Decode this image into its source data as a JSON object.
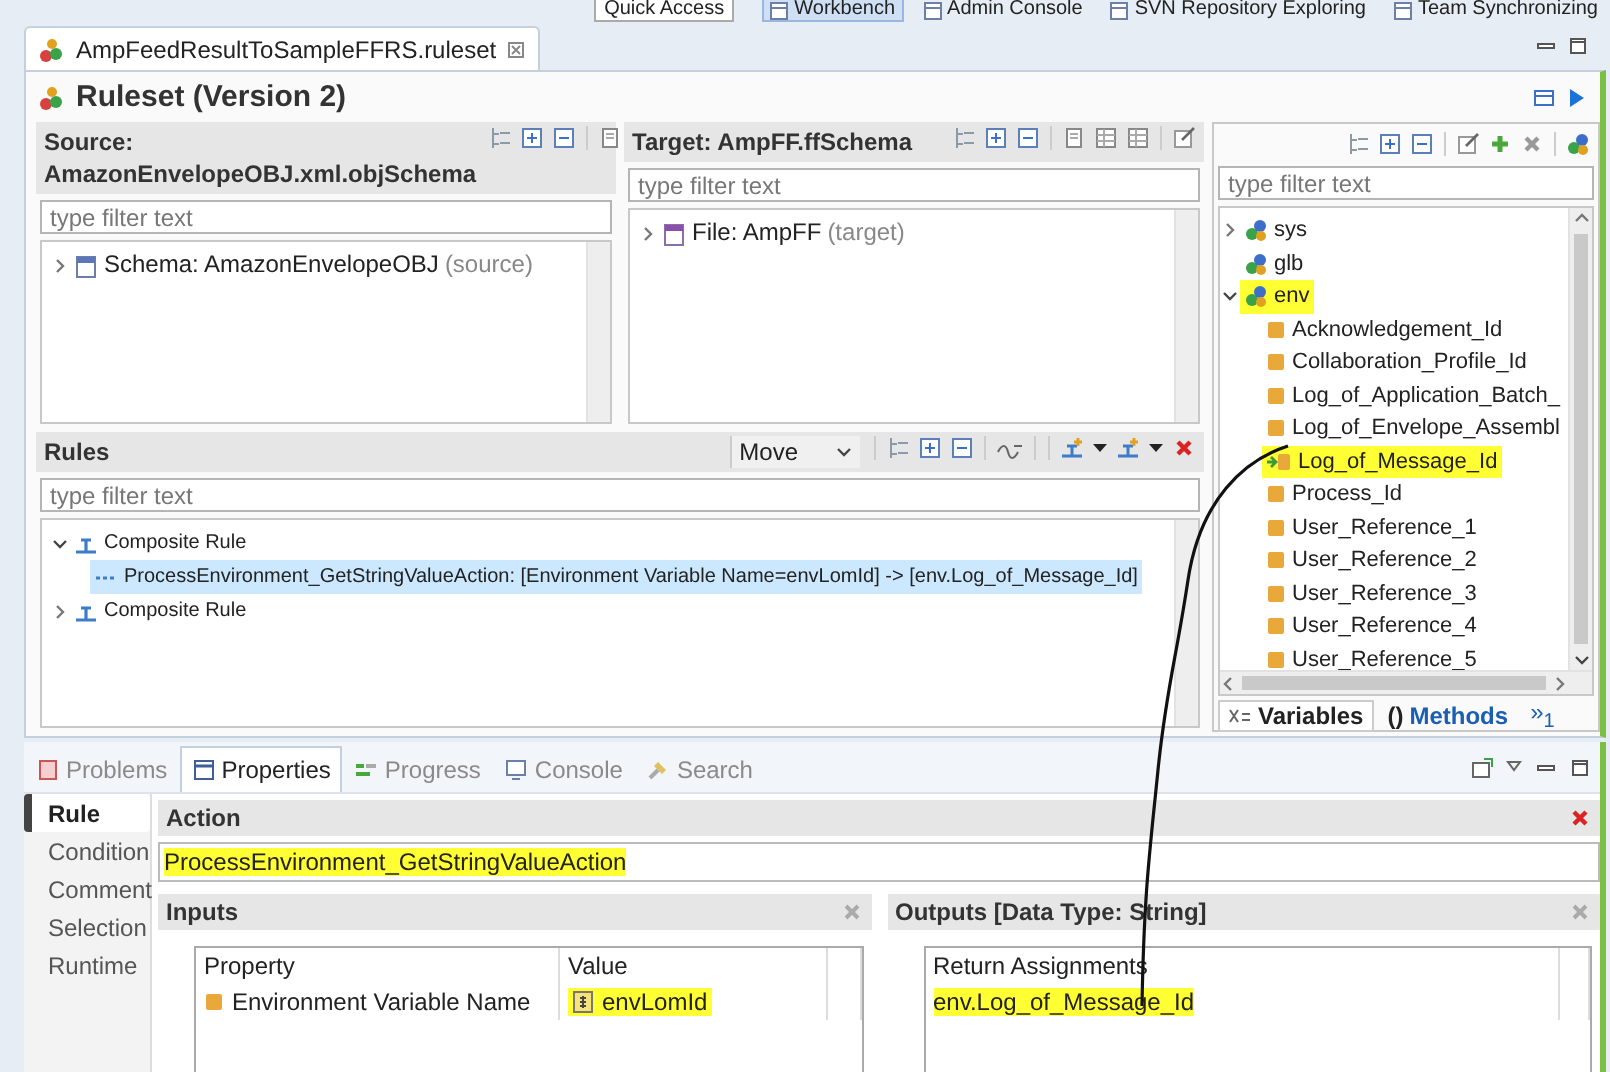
{
  "perspective_bar": {
    "quick_access": "Quick Access",
    "perspectives": [
      {
        "label": "Workbench",
        "selected": true
      },
      {
        "label": "Admin Console",
        "selected": false
      },
      {
        "label": "SVN Repository Exploring",
        "selected": false
      },
      {
        "label": "Team Synchronizing",
        "selected": false
      }
    ]
  },
  "editor_tab": {
    "title": "AmpFeedResultToSampleFFRS.ruleset"
  },
  "ruleset_title": "Ruleset (Version 2)",
  "source": {
    "title": "Source: AmazonEnvelopeOBJ.xml.objSchema",
    "filter_placeholder": "type filter text",
    "tree": [
      {
        "label": "Schema: AmazonEnvelopeOBJ",
        "note": "(source)",
        "kind": "schema",
        "expanded": false
      }
    ]
  },
  "target": {
    "title": "Target: AmpFF.ffSchema",
    "filter_placeholder": "type filter text",
    "tree": [
      {
        "label": "File: AmpFF",
        "note": "(target)",
        "kind": "file",
        "expanded": false
      }
    ]
  },
  "rules": {
    "title": "Rules",
    "mode": "Move",
    "filter_placeholder": "type filter text",
    "tree": [
      {
        "label": "Composite Rule",
        "kind": "rule",
        "expanded": true,
        "selected": false,
        "children": [
          {
            "label": "ProcessEnvironment_GetStringValueAction: [Environment Variable Name=envLomId] -> [env.Log_of_Message_Id]",
            "kind": "action",
            "selected": true
          }
        ]
      },
      {
        "label": "Composite Rule",
        "kind": "rule",
        "expanded": false,
        "selected": false
      }
    ]
  },
  "variables": {
    "filter_placeholder": "type filter text",
    "tree": [
      {
        "label": "sys",
        "kind": "group",
        "expanded": false,
        "highlighted": false
      },
      {
        "label": "glb",
        "kind": "group",
        "highlighted": false
      },
      {
        "label": "env",
        "kind": "group",
        "expanded": true,
        "highlighted": true,
        "children": [
          {
            "label": "Acknowledgement_Id",
            "kind": "field",
            "highlighted": false
          },
          {
            "label": "Collaboration_Profile_Id",
            "kind": "field",
            "highlighted": false
          },
          {
            "label": "Log_of_Application_Batch_",
            "kind": "field",
            "highlighted": false
          },
          {
            "label": "Log_of_Envelope_Assembl",
            "kind": "field",
            "highlighted": false
          },
          {
            "label": "Log_of_Message_Id",
            "kind": "mapped_field",
            "highlighted": true
          },
          {
            "label": "Process_Id",
            "kind": "field",
            "highlighted": false
          },
          {
            "label": "User_Reference_1",
            "kind": "field",
            "highlighted": false
          },
          {
            "label": "User_Reference_2",
            "kind": "field",
            "highlighted": false
          },
          {
            "label": "User_Reference_3",
            "kind": "field",
            "highlighted": false
          },
          {
            "label": "User_Reference_4",
            "kind": "field",
            "highlighted": false
          },
          {
            "label": "User_Reference_5",
            "kind": "field",
            "highlighted": false
          }
        ]
      }
    ],
    "tabs": [
      {
        "label": "Variables",
        "selected": true
      },
      {
        "label": "Methods",
        "glyph": "()",
        "selected": false
      }
    ],
    "more_tabs": "»$_{1}$"
  },
  "bottom_view": {
    "tabs": [
      {
        "label": "Problems",
        "selected": false
      },
      {
        "label": "Properties",
        "selected": true
      },
      {
        "label": "Progress",
        "selected": false
      },
      {
        "label": "Console",
        "selected": false
      },
      {
        "label": "Search",
        "selected": false
      }
    ],
    "side_tabs": [
      {
        "label": "Rule",
        "selected": true
      },
      {
        "label": "Condition",
        "selected": false
      },
      {
        "label": "Comment",
        "selected": false
      },
      {
        "label": "Selection",
        "selected": false
      },
      {
        "label": "Runtime",
        "selected": false
      }
    ],
    "action": {
      "title": "Action",
      "value": "ProcessEnvironment_GetStringValueAction",
      "highlighted": true
    },
    "inputs": {
      "title": "Inputs",
      "columns": [
        "Property",
        "Value"
      ],
      "rows": [
        {
          "property": "Environment Variable Name",
          "value": "envLomId",
          "highlighted": true
        }
      ]
    },
    "outputs": {
      "title": "Outputs [Data Type: String]",
      "columns": [
        "Return Assignments"
      ],
      "rows": [
        {
          "value": "env.Log_of_Message_Id",
          "highlighted": true
        }
      ]
    }
  }
}
